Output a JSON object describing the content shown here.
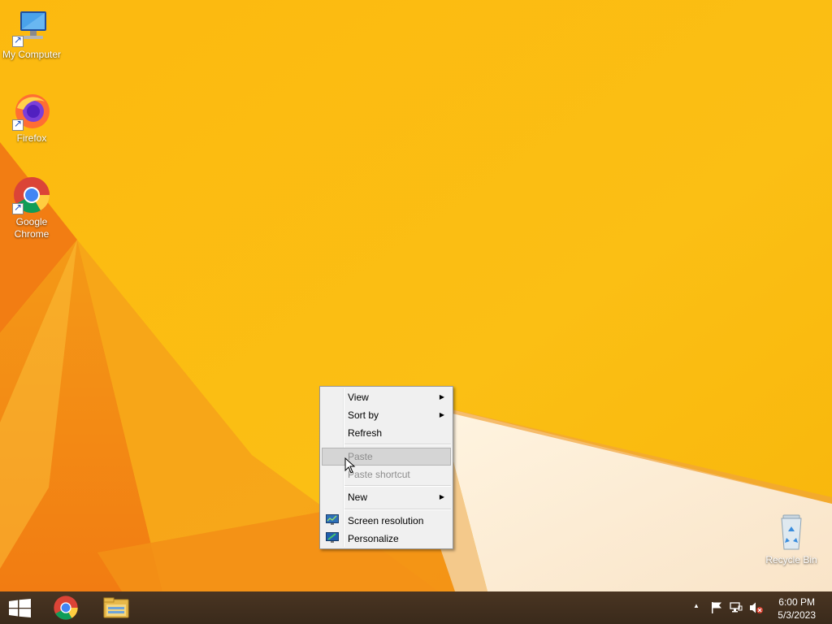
{
  "desktop": {
    "icons": [
      {
        "label": "My Computer",
        "icon": "computer-icon"
      },
      {
        "label": "Firefox",
        "icon": "firefox-icon"
      },
      {
        "label": "Google\nChrome",
        "icon": "chrome-icon"
      },
      {
        "label": "Recycle Bin",
        "icon": "recycle-bin-icon"
      }
    ]
  },
  "context_menu": {
    "items": [
      {
        "label": "View",
        "submenu": true,
        "enabled": true
      },
      {
        "label": "Sort by",
        "submenu": true,
        "enabled": true
      },
      {
        "label": "Refresh",
        "submenu": false,
        "enabled": true
      },
      {
        "label": "Paste",
        "submenu": false,
        "enabled": false,
        "hovered": true
      },
      {
        "label": "Paste shortcut",
        "submenu": false,
        "enabled": false
      },
      {
        "label": "New",
        "submenu": true,
        "enabled": true
      },
      {
        "label": "Screen resolution",
        "submenu": false,
        "enabled": true,
        "icon": "display-icon"
      },
      {
        "label": "Personalize",
        "submenu": false,
        "enabled": true,
        "icon": "personalize-icon"
      }
    ],
    "arrow_glyph": "▶"
  },
  "taskbar": {
    "pinned": [
      {
        "name": "start",
        "icon": "windows-logo-icon"
      },
      {
        "name": "chrome",
        "icon": "chrome-icon"
      },
      {
        "name": "file-explorer",
        "icon": "folder-icon"
      }
    ],
    "tray": {
      "overflow_glyph": "▲",
      "icons": [
        "action-center-flag-icon",
        "network-icon",
        "volume-muted-icon"
      ],
      "time": "6:00 PM",
      "date": "5/3/2023"
    }
  },
  "colors": {
    "wallpaper": "#fbbd0e",
    "accent_orange": "#f08a18",
    "taskbar": "#3f2d1e"
  }
}
